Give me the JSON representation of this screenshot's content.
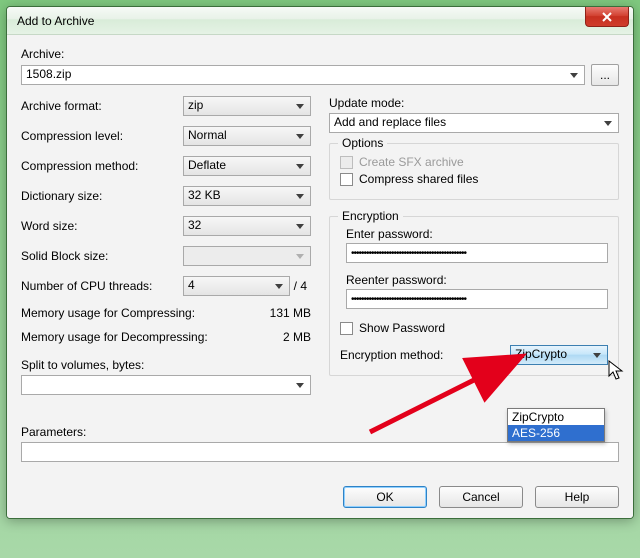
{
  "window": {
    "title": "Add to Archive"
  },
  "archive": {
    "label": "Archive:",
    "value": "1508.zip",
    "browse": "..."
  },
  "left": {
    "format_label": "Archive format:",
    "format_value": "zip",
    "level_label": "Compression level:",
    "level_value": "Normal",
    "method_label": "Compression method:",
    "method_value": "Deflate",
    "dict_label": "Dictionary size:",
    "dict_value": "32 KB",
    "word_label": "Word size:",
    "word_value": "32",
    "solid_label": "Solid Block size:",
    "solid_value": "",
    "threads_label": "Number of CPU threads:",
    "threads_value": "4",
    "threads_total": "/ 4",
    "mem_comp_label": "Memory usage for Compressing:",
    "mem_comp_value": "131 MB",
    "mem_decomp_label": "Memory usage for Decompressing:",
    "mem_decomp_value": "2 MB",
    "split_label": "Split to volumes, bytes:",
    "split_value": ""
  },
  "right": {
    "update_label": "Update mode:",
    "update_value": "Add and replace files",
    "options_legend": "Options",
    "sfx_label": "Create SFX archive",
    "shared_label": "Compress shared files",
    "enc_legend": "Encryption",
    "pwd_label": "Enter password:",
    "pwd_value": "••••••••••••••••••••••••••••••••••••••••••••••",
    "repwd_label": "Reenter password:",
    "repwd_value": "••••••••••••••••••••••••••••••••••••••••••••••",
    "showpwd_label": "Show Password",
    "encmethod_label": "Encryption method:",
    "encmethod_value": "ZipCrypto",
    "encmethod_options": [
      "ZipCrypto",
      "AES-256"
    ]
  },
  "params": {
    "label": "Parameters:",
    "value": ""
  },
  "buttons": {
    "ok": "OK",
    "cancel": "Cancel",
    "help": "Help"
  }
}
